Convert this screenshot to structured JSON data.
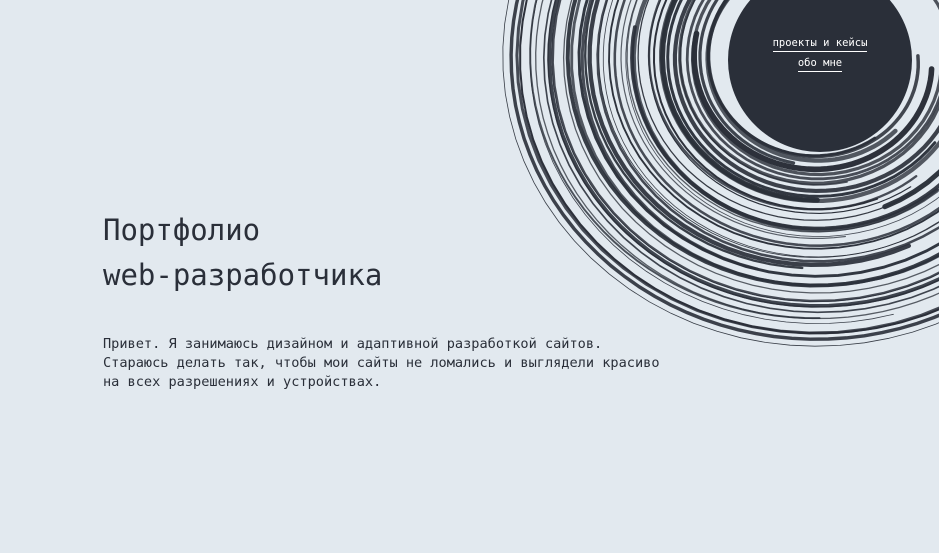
{
  "colors": {
    "background": "#e2e9ef",
    "swirl": "#2a2f39",
    "text": "#2a2f39",
    "nav_text": "#ffffff"
  },
  "nav": {
    "items": [
      {
        "label": "проекты и кейсы"
      },
      {
        "label": "обо мне"
      }
    ]
  },
  "hero": {
    "title_line1": "Портфолио",
    "title_line2": "web-разработчика"
  },
  "intro": {
    "lines": [
      "Привет. Я занимаюсь дизайном и адаптивной разработкой сайтов.",
      "Стараюсь делать так, чтобы мои сайты не ломались и выглядели красиво",
      "на всех разрешениях и устройствах."
    ]
  },
  "decor": {
    "swirl_icon": "ink-swirl-circle"
  }
}
